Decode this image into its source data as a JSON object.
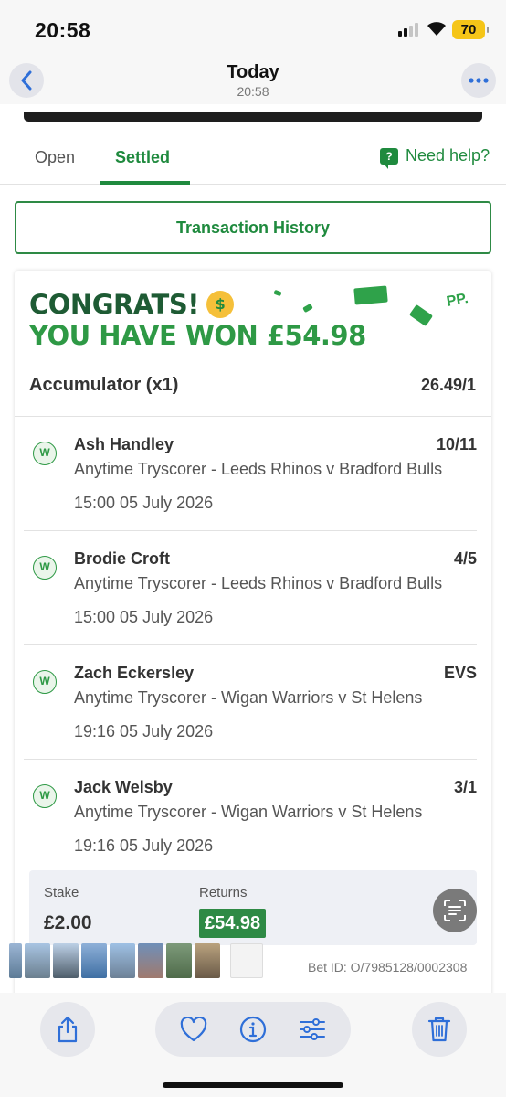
{
  "status_bar": {
    "time": "20:58",
    "battery": "70"
  },
  "header": {
    "title": "Today",
    "subtitle": "20:58"
  },
  "tabs": {
    "open": "Open",
    "settled": "Settled",
    "help": "Need help?"
  },
  "transaction_history": "Transaction History",
  "banner": {
    "line1": "CONGRATS!",
    "line2": "YOU HAVE WON £54.98",
    "pp": "PP."
  },
  "bet": {
    "type": "Accumulator (x1)",
    "odds": "26.49/1",
    "legs": [
      {
        "result": "W",
        "name": "Ash Handley",
        "odds": "10/11",
        "market": "Anytime Tryscorer - Leeds Rhinos v Bradford Bulls",
        "time": "15:00 05 July 2026"
      },
      {
        "result": "W",
        "name": "Brodie Croft",
        "odds": "4/5",
        "market": "Anytime Tryscorer - Leeds Rhinos v Bradford Bulls",
        "time": "15:00 05 July 2026"
      },
      {
        "result": "W",
        "name": "Zach Eckersley",
        "odds": "EVS",
        "market": "Anytime Tryscorer - Wigan Warriors v St Helens",
        "time": "19:16 05 July 2026"
      },
      {
        "result": "W",
        "name": "Jack Welsby",
        "odds": "3/1",
        "market": "Anytime Tryscorer - Wigan Warriors v St Helens",
        "time": "19:16 05 July 2026"
      }
    ],
    "stake_label": "Stake",
    "stake": "£2.00",
    "returns_label": "Returns",
    "returns": "£54.98",
    "bet_id": "Bet ID: O/7985128/0002308"
  },
  "colors": {
    "accent": "#1f8a3e",
    "dark_green": "#1e5b34",
    "ios_blue": "#2f6fd8"
  },
  "icons": [
    "back-chevron-icon",
    "more-icon",
    "help-chat-icon",
    "share-icon",
    "heart-icon",
    "info-icon",
    "sliders-icon",
    "trash-icon",
    "scan-text-icon"
  ]
}
